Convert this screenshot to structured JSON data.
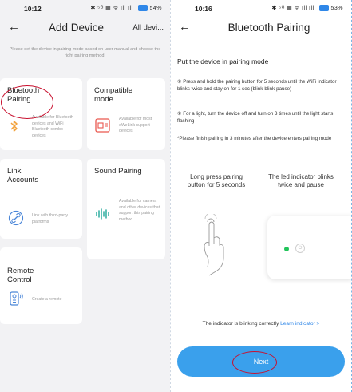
{
  "left": {
    "status": {
      "time": "10:12",
      "icons": "✱ ⁵ᴳ ▦ ᯤ ıll ıll",
      "battery": "54%"
    },
    "header": {
      "title": "Add Device",
      "right_label": "All devi..."
    },
    "instruction": "Please set the device in pairing mode based on user manual and choose the right pairing method.",
    "cards": [
      {
        "name": "Bluetooth Pairing",
        "desc": "Available for Bluetooth devices and WiFi Bluetooth combo devices",
        "icon": "bluetooth-icon"
      },
      {
        "name": "Compatible mode",
        "desc": "Available for most eWeLink support devices",
        "icon": "compatible-mode-icon"
      },
      {
        "name": "Link Accounts",
        "desc": "Link with third-party platforms",
        "icon": "link-icon"
      },
      {
        "name": "Sound Pairing",
        "desc": "Available for camera and other devices that support this pairing method.",
        "icon": "sound-wave-icon"
      },
      {
        "name": "Remote Control",
        "desc": "Create a remote",
        "icon": "remote-icon"
      }
    ]
  },
  "right": {
    "status": {
      "time": "10:16",
      "icons": "✱ ⁵ᴳ ▦ ᯤ ıll ıll",
      "battery": "53%"
    },
    "header": {
      "title": "Bluetooth Pairing"
    },
    "section_title": "Put the device in pairing mode",
    "step1": "① Press and hold the pairing button for 5 seconds until the WiFi indicator blinks twice and stay on for 1 sec (blink-blink-pause)",
    "step2": "② For a light, turn the device off and turn on 3 times until the light starts flashing",
    "note": "*Please finish pairing in 3 minutes after the device enters pairing mode",
    "illus_left": "Long press pairing button for 5 seconds",
    "illus_right": "The led indicator blinks twice and pause",
    "blink_text": "The indicator is blinking correctly",
    "learn_link": "Learn indicator >",
    "next_button": "Next"
  },
  "colors": {
    "accent": "#2f87e8",
    "button": "#3aa0ec",
    "led": "#21c45a",
    "highlight_circle": "#c8102e"
  }
}
